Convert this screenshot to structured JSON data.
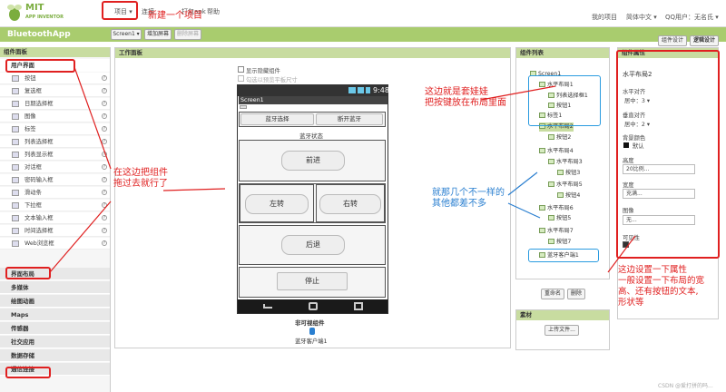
{
  "topbar": {
    "logo_mit": "MIT",
    "logo_sub": "APP INVENTOR",
    "menu_project": "项目 ▾",
    "menu_connect": "连接",
    "menu_build": "打包apk",
    "menu_help": "帮助",
    "my_projects": "我的项目",
    "language": "简体中文 ▾",
    "user": "QQ用户：无名氏 ▾"
  },
  "annotations": {
    "new_project": "新建一个项目",
    "drag_components": "在这边把组件\n拖过去就行了",
    "nesting": "这边就是套娃娃\n把按键放在布局里面",
    "similar": "就那几个不一样的\n其他都差不多",
    "properties": "这边设置一下属性\n一般设置一下布局的宽\n高、还有按钮的文本,\n形状等"
  },
  "appbar": {
    "title": "BluetoothApp",
    "screen_select": "Screen1 ▾",
    "add_screen": "增加屏幕",
    "delete_screen": "删除屏幕",
    "component_design": "组件设计",
    "logic_design": "逻辑设计"
  },
  "palette": {
    "title": "组件面板",
    "category_ui": "用户界面",
    "items": [
      "按钮",
      "复选框",
      "日期选择框",
      "图像",
      "标签",
      "列表选择框",
      "列表显示框",
      "对话框",
      "密码输入框",
      "滑动条",
      "下拉框",
      "文本输入框",
      "时间选择框",
      "Web浏览框"
    ],
    "categories": [
      "界面布局",
      "多媒体",
      "绘图动画",
      "Maps",
      "传感器",
      "社交应用",
      "数据存储",
      "通信连接"
    ]
  },
  "workarea": {
    "title": "工作面板",
    "show_hidden": "显示隐藏组件",
    "phone_size": "勾选以预览平板尺寸",
    "time": "9:48",
    "screen_name": "Screen1",
    "btn_bt_select": "蓝牙选择",
    "btn_bt_disconnect": "断开蓝牙",
    "bt_status": "蓝牙状态",
    "btn_forward": "前进",
    "btn_left": "左转",
    "btn_right": "右转",
    "btn_back": "后退",
    "btn_stop": "停止",
    "nonvisible_title": "非可视组件",
    "nonvisible_item": "蓝牙客户端1"
  },
  "tree": {
    "title": "组件列表",
    "items": [
      {
        "label": "Screen1",
        "level": 0
      },
      {
        "label": "水平布局1",
        "level": 1
      },
      {
        "label": "列表选择框1",
        "level": 2
      },
      {
        "label": "按钮1",
        "level": 2
      },
      {
        "label": "标签1",
        "level": 1
      },
      {
        "label": "水平布局2",
        "level": 1
      },
      {
        "label": "按钮2",
        "level": 2
      },
      {
        "label": "水平布局4",
        "level": 1
      },
      {
        "label": "水平布局3",
        "level": 2
      },
      {
        "label": "按钮3",
        "level": 3
      },
      {
        "label": "水平布局5",
        "level": 2
      },
      {
        "label": "按钮4",
        "level": 3
      },
      {
        "label": "水平布局6",
        "level": 1
      },
      {
        "label": "按钮5",
        "level": 2
      },
      {
        "label": "水平布局7",
        "level": 1
      },
      {
        "label": "按钮7",
        "level": 2
      },
      {
        "label": "蓝牙客户端1",
        "level": 1
      }
    ],
    "rename": "重命名",
    "delete": "删除",
    "media_title": "素材",
    "upload": "上传文件..."
  },
  "props": {
    "title": "组件属性",
    "component": "水平布局2",
    "h_align_label": "水平对齐",
    "h_align_value": "居中：3 ▾",
    "v_align_label": "垂直对齐",
    "v_align_value": "居中：2 ▾",
    "bg_label": "背景颜色",
    "bg_value": "默认",
    "height_label": "高度",
    "height_value": "20比例...",
    "width_label": "宽度",
    "width_value": "充满...",
    "image_label": "图像",
    "image_value": "无...",
    "visible_label": "可见性"
  },
  "watermark": "CSDN @爱打拼的吗..."
}
